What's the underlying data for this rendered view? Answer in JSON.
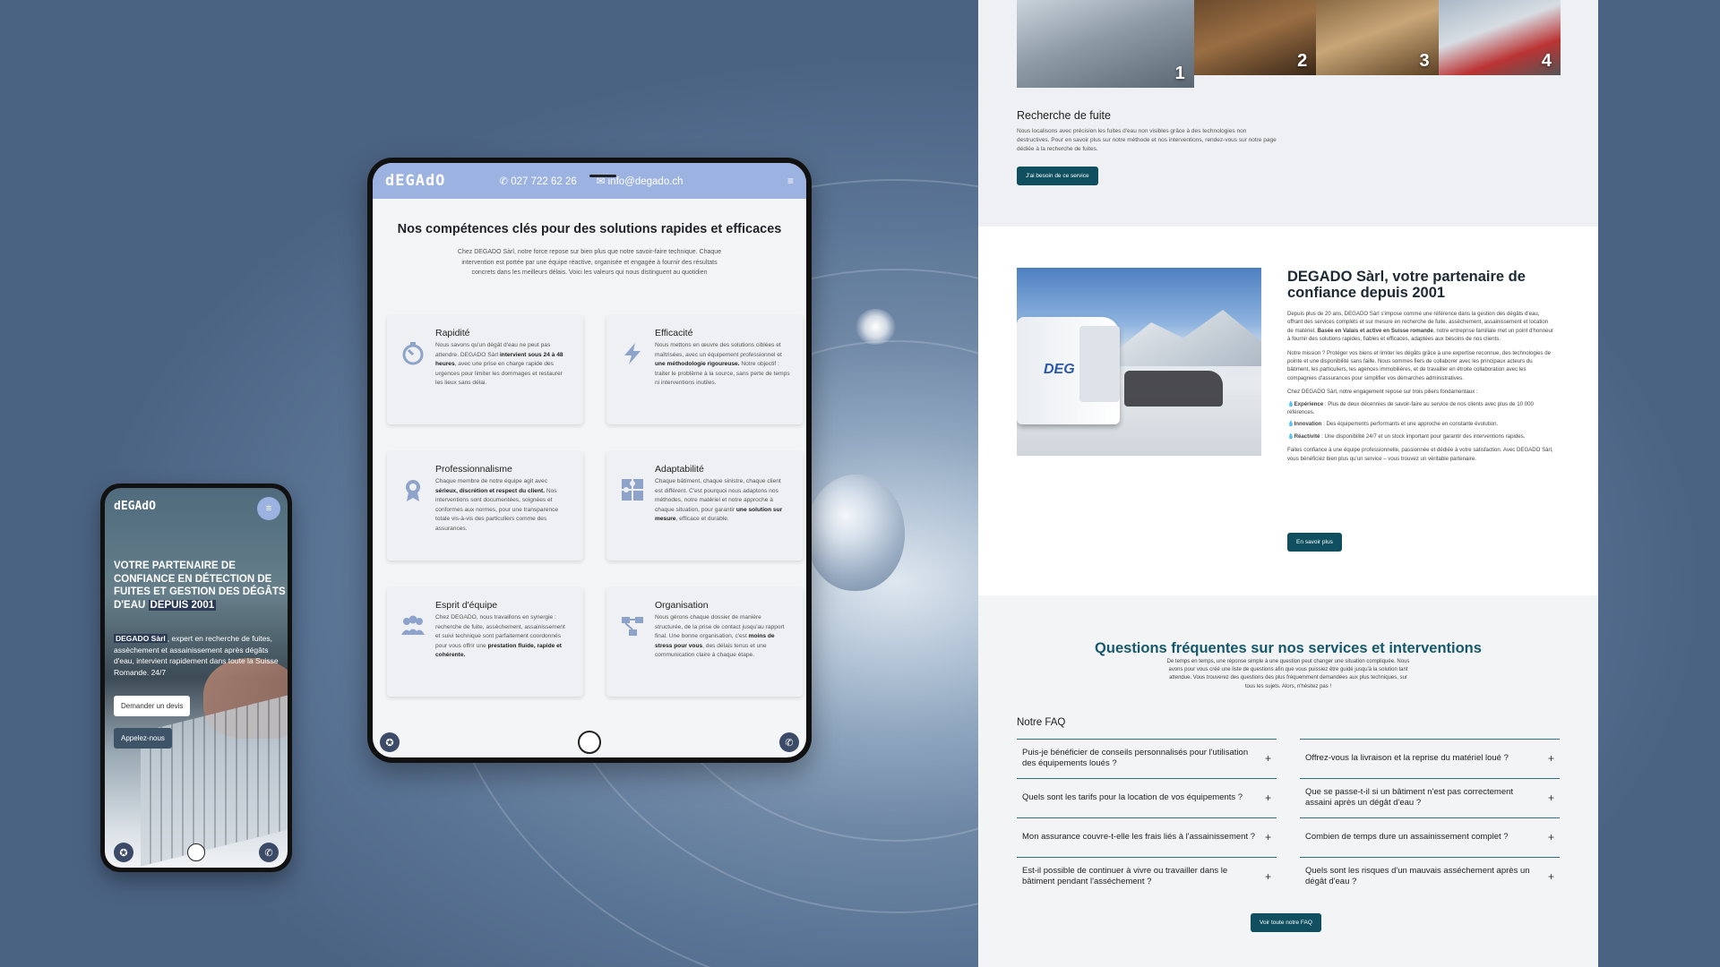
{
  "desktop": {
    "gallery": {
      "numbers": [
        "1",
        "2",
        "3",
        "4"
      ]
    },
    "leak": {
      "title": "Recherche de fuite",
      "text": "Nous localisons avec précision les fuites d'eau non visibles grâce à des technologies non destructives. Pour en savoir plus sur notre méthode et nos interventions, rendez-vous sur notre page dédiée à la recherche de fuites.",
      "button": "J'ai besoin de ce service"
    },
    "about": {
      "title": "DEGADO Sàrl, votre partenaire de confiance depuis 2001",
      "van_logo": "DEG",
      "p1_a": "Depuis plus de 20 ans, DEGADO Sàrl s'impose comme une référence dans la gestion des dégâts d'eau, offrant des services complets et sur mesure en recherche de fuite, assèchement, assainissement et location de matériel. ",
      "p1_b": "Basée en Valais et active en Suisse romande",
      "p1_c": ", notre entreprise familiale met un point d'honneur à fournir des solutions rapides, fiables et efficaces, adaptées aux besoins de nos clients.",
      "p2": "Notre mission ? Protéger vos biens et limiter les dégâts grâce à une expertise reconnue, des technologies de pointe et une disponibilité sans faille. Nous sommes fiers de collaborer avec les principaux acteurs du bâtiment, les particuliers, les agences immobilières, et de travailler en étroite collaboration avec les compagnies d'assurances pour simplifier vos démarches administratives.",
      "p3": "Chez DEGADO Sàrl, notre engagement repose sur trois piliers fondamentaux :",
      "pillars": [
        {
          "label": "Expérience",
          "text": " : Plus de deux décennies de savoir-faire au service de nos clients avec plus de 10 000 références."
        },
        {
          "label": "Innovation",
          "text": " : Des équipements performants et une approche en constante évolution."
        },
        {
          "label": "Réactivité",
          "text": " : Une disponibilité 24/7 et un stock important pour garantir des interventions rapides."
        }
      ],
      "p4": "Faites confiance à une équipe professionnelle, passionnée et dédiée à votre satisfaction. Avec DEGADO Sàrl, vous bénéficiez bien plus qu'un service – vous trouvez un véritable partenaire.",
      "button": "En savoir plus"
    },
    "faq": {
      "title": "Questions fréquentes sur nos services et interventions",
      "subtitle": "De temps en temps, une réponse simple à une question peut changer une situation compliquée. Nous avons pour vous créé une liste de questions afin que vous puissiez être guidé jusqu'à la solution tant attendue. Vous trouverez des questions des plus fréquemment demandées aux plus techniques, sur tous les sujets. Alors, n'hésitez pas !",
      "label": "Notre FAQ",
      "left": [
        "Puis-je bénéficier de conseils personnalisés pour l'utilisation des équipements loués ?",
        "Quels sont les tarifs pour la location de vos équipements ?",
        "Mon assurance couvre-t-elle les frais liés à l'assainissement ?",
        "Est-il possible de continuer à vivre ou travailler dans le bâtiment pendant l'asséchement ?"
      ],
      "right": [
        "Offrez-vous la livraison et la reprise du matériel loué ?",
        "Que se passe-t-il si un bâtiment n'est pas correctement assaini après un dégât d'eau ?",
        "Combien de temps dure un assainissement complet ?",
        "Quels sont les risques d'un mauvais asséchement après un dégât d'eau ?"
      ],
      "plus": "+",
      "button": "Voir toute notre FAQ"
    }
  },
  "tablet": {
    "logo": "dEGAdO",
    "phone": "✆ 027 722 62 26",
    "email": "✉ info@degado.ch",
    "menu_icon": "≡",
    "heading": "Nos compétences clés pour des solutions rapides et efficaces",
    "intro": "Chez DEGADO Sàrl, notre force repose sur bien plus que notre savoir-faire technique. Chaque intervention est portée par une équipe réactive, organisée et engagée à fournir des résultats concrets dans les meilleurs délais. Voici les valeurs qui nous distinguent au quotidien",
    "cards": [
      {
        "title": "Rapidité",
        "a": "Nous savons qu'un dégât d'eau ne peut pas attendre. DEGADO Sàrl ",
        "b": "intervient sous 24 à 48 heures",
        "c": ", avec une prise en charge rapide des urgences pour limiter les dommages et restaurer les lieux sans délai."
      },
      {
        "title": "Efficacité",
        "a": "Nous mettons en œuvre des solutions ciblées et maîtrisées, avec un équipement professionnel et ",
        "b": "une méthodologie rigoureuse.",
        "c": " Notre objectif : traiter le problème à la source, sans perte de temps ni interventions inutiles."
      },
      {
        "title": "Professionnalisme",
        "a": "Chaque membre de notre équipe agit avec ",
        "b": "sérieux, discrétion et respect du client.",
        "c": " Nos interventions sont documentées, soignées et conformes aux normes, pour une transparence totale vis-à-vis des particuliers comme des assurances."
      },
      {
        "title": "Adaptabilité",
        "a": "Chaque bâtiment, chaque sinistre, chaque client est différent. C'est pourquoi nous adaptons nos méthodes, notre matériel et notre approche à chaque situation, pour garantir ",
        "b": "une solution sur mesure",
        "c": ", efficace et durable."
      },
      {
        "title": "Esprit d'équipe",
        "a": "Chez DEGADO, nous travaillons en synergie : recherche de fuite, assèchement, assainissement et suivi technique sont parfaitement coordonnés pour vous offrir une ",
        "b": "prestation fluide, rapide et cohérente.",
        "c": ""
      },
      {
        "title": "Organisation",
        "a": "Nous gérons chaque dossier de manière structurée, de la prise de contact jusqu'au rapport final. Une bonne organisation, c'est ",
        "b": "moins de stress pour vous",
        "c": ", des délais tenus et une communication claire à chaque étape."
      }
    ],
    "card_icons": [
      "stopwatch-icon",
      "lightning-icon",
      "award-icon",
      "puzzle-icon",
      "team-icon",
      "workflow-icon"
    ]
  },
  "phone": {
    "logo": "dEGAdO",
    "menu_icon": "≡",
    "headline": "VOTRE PARTENAIRE DE CONFIANCE EN DÉTECTION DE FUITES ET GESTION DES DÉGÂTS D'EAU ",
    "headline_hl": "DEPUIS 2001",
    "brand": "DEGADO Sàrl",
    "text": ", expert en recherche de fuites, assèchement et assainissement après dégâts d'eau, intervient rapidement dans toute la Suisse Romande. 24/7",
    "btn_quote": "Demander un devis",
    "btn_call": "Appelez-nous"
  },
  "colors": {
    "accent_dark": "#0f4f5f",
    "faq_title": "#17586b",
    "header_blue": "#9cb2e0"
  }
}
